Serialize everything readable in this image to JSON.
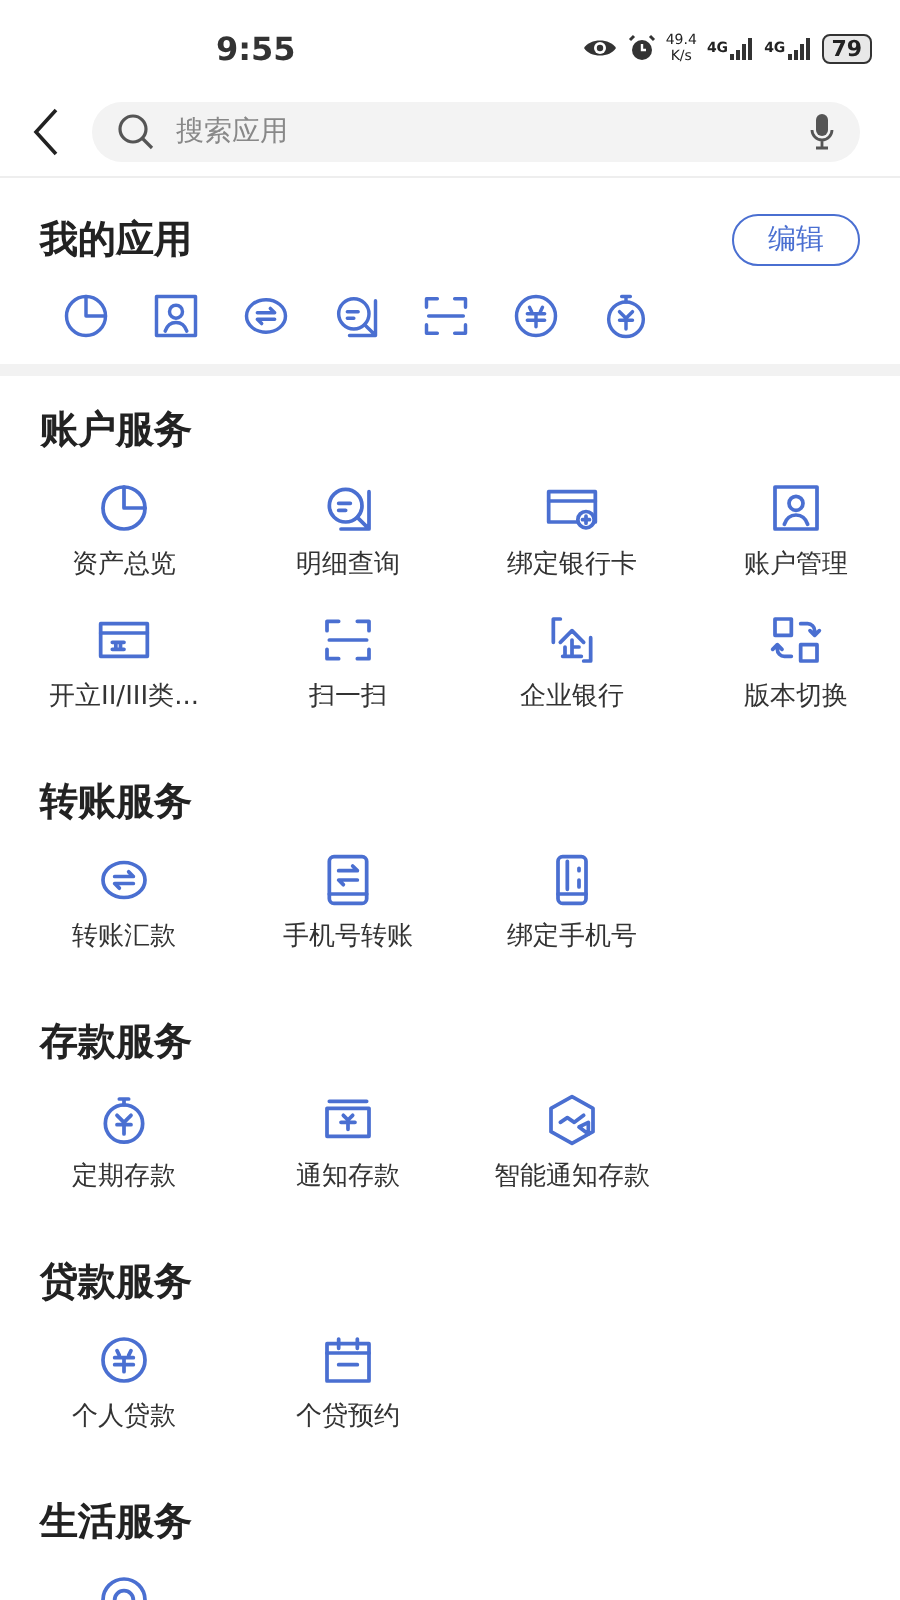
{
  "status_bar": {
    "time": "9:55",
    "speed_value": "49.4",
    "speed_unit": "K/s",
    "networks": [
      "4G",
      "4G"
    ],
    "battery": "79"
  },
  "search": {
    "placeholder": "搜索应用"
  },
  "my_apps": {
    "title": "我的应用",
    "edit_button": "编辑",
    "icons": [
      {
        "kind": "pie"
      },
      {
        "kind": "person-card"
      },
      {
        "kind": "transfer"
      },
      {
        "kind": "search-list"
      },
      {
        "kind": "scan"
      },
      {
        "kind": "loan"
      },
      {
        "kind": "timer"
      }
    ]
  },
  "sections": [
    {
      "title": "账户服务",
      "items": [
        {
          "kind": "pie",
          "label": "资产总览"
        },
        {
          "kind": "search-list",
          "label": "明细查询"
        },
        {
          "kind": "card-add",
          "label": "绑定银行卡"
        },
        {
          "kind": "person-card",
          "label": "账户管理"
        },
        {
          "kind": "card",
          "label": "开立II/III类..."
        },
        {
          "kind": "scan",
          "label": "扫一扫"
        },
        {
          "kind": "building",
          "label": "企业银行"
        },
        {
          "kind": "switch",
          "label": "版本切换"
        }
      ]
    },
    {
      "title": "转账服务",
      "items": [
        {
          "kind": "transfer",
          "label": "转账汇款"
        },
        {
          "kind": "tablet",
          "label": "手机号转账"
        },
        {
          "kind": "phone",
          "label": "绑定手机号"
        }
      ]
    },
    {
      "title": "存款服务",
      "items": [
        {
          "kind": "timer",
          "label": "定期存款"
        },
        {
          "kind": "deposit",
          "label": "通知存款"
        },
        {
          "kind": "hexagon",
          "label": "智能通知存款"
        }
      ]
    },
    {
      "title": "贷款服务",
      "items": [
        {
          "kind": "loan",
          "label": "个人贷款"
        },
        {
          "kind": "calendar",
          "label": "个贷预约"
        }
      ]
    },
    {
      "title": "生活服务",
      "items": [
        {
          "kind": "ring"
        }
      ]
    }
  ]
}
